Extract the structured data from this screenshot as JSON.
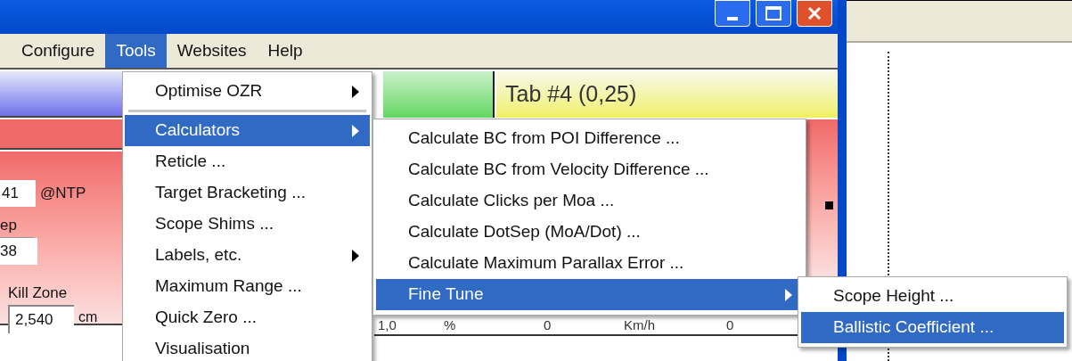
{
  "menu_bar": [
    {
      "label": "Configure",
      "selected": false
    },
    {
      "label": "Tools",
      "selected": true
    },
    {
      "label": "Websites",
      "selected": false
    },
    {
      "label": "Help",
      "selected": false
    }
  ],
  "tab": {
    "label": "Tab #4 (0,25)"
  },
  "left_panel": {
    "field_1": "41",
    "unit_1": "@NTP",
    "label_2": "ep",
    "field_2": "38",
    "label_3": "Kill Zone",
    "field_3": "2,540",
    "unit_3": "cm"
  },
  "bottom_row": [
    "1,0",
    "%",
    "0",
    "Km/h",
    "0"
  ],
  "tools_menu": [
    {
      "kind": "item",
      "label": "Optimise OZR",
      "submenu": true,
      "selected": false
    },
    {
      "kind": "separator"
    },
    {
      "kind": "item",
      "label": "Calculators",
      "submenu": true,
      "selected": true
    },
    {
      "kind": "item",
      "label": "Reticle ...",
      "submenu": false,
      "selected": false
    },
    {
      "kind": "item",
      "label": "Target Bracketing ...",
      "submenu": false,
      "selected": false
    },
    {
      "kind": "item",
      "label": "Scope Shims ...",
      "submenu": false,
      "selected": false
    },
    {
      "kind": "item",
      "label": "Labels, etc.",
      "submenu": true,
      "selected": false
    },
    {
      "kind": "item",
      "label": "Maximum Range ...",
      "submenu": false,
      "selected": false
    },
    {
      "kind": "item",
      "label": "Quick Zero ...",
      "submenu": false,
      "selected": false
    },
    {
      "kind": "item",
      "label": "Visualisation",
      "submenu": false,
      "selected": false
    }
  ],
  "calculators_menu": [
    {
      "label": "Calculate BC from POI Difference ...",
      "submenu": false,
      "selected": false
    },
    {
      "label": "Calculate BC from Velocity Difference ...",
      "submenu": false,
      "selected": false
    },
    {
      "label": "Calculate Clicks per Moa ...",
      "submenu": false,
      "selected": false
    },
    {
      "label": "Calculate DotSep (MoA/Dot) ...",
      "submenu": false,
      "selected": false
    },
    {
      "label": "Calculate Maximum Parallax Error ...",
      "submenu": false,
      "selected": false
    },
    {
      "label": "Fine Tune",
      "submenu": true,
      "selected": true
    }
  ],
  "fine_tune_menu": [
    {
      "label": "Scope Height ...",
      "selected": false
    },
    {
      "label": "Ballistic Coefficient ...",
      "selected": true
    }
  ]
}
